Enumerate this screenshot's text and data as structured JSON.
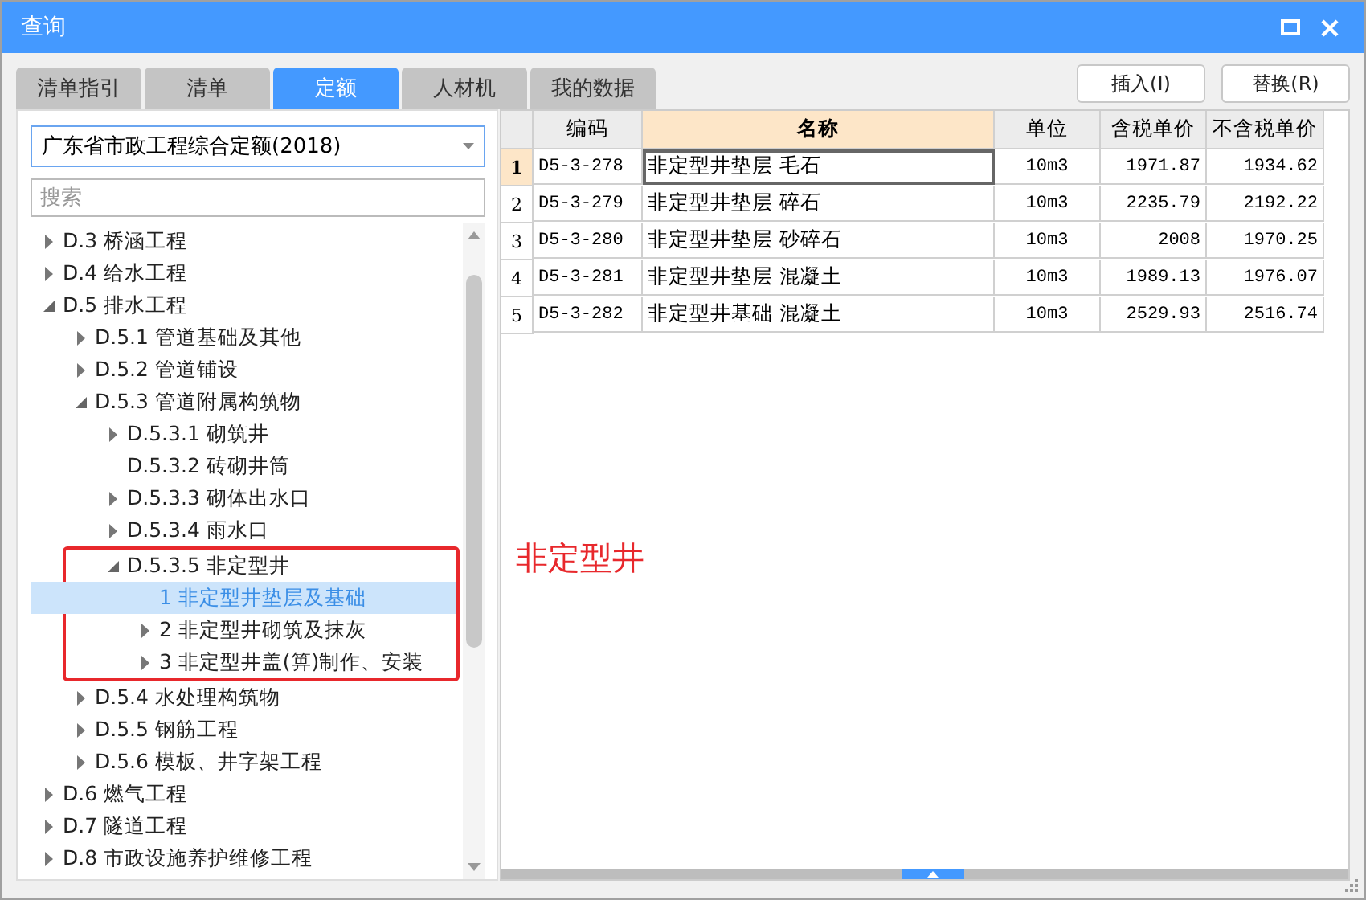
{
  "window": {
    "title": "查询"
  },
  "tabs": [
    {
      "label": "清单指引",
      "selected": false
    },
    {
      "label": "清单",
      "selected": false
    },
    {
      "label": "定额",
      "selected": true
    },
    {
      "label": "人材机",
      "selected": false
    },
    {
      "label": "我的数据",
      "selected": false
    }
  ],
  "buttons": [
    "插入(I)",
    "替换(R)"
  ],
  "library_select": {
    "value": "广东省市政工程综合定额(2018)"
  },
  "search": {
    "placeholder": "搜索"
  },
  "tree": [
    {
      "label": "D.3 桥涵工程",
      "expanded": false,
      "selected": false
    },
    {
      "label": "D.4 给水工程",
      "expanded": false,
      "selected": false
    },
    {
      "label": "D.5 排水工程",
      "expanded": true,
      "selected": false,
      "children": [
        {
          "label": "D.5.1 管道基础及其他",
          "expanded": false,
          "selected": false
        },
        {
          "label": "D.5.2 管道铺设",
          "expanded": false,
          "selected": false
        },
        {
          "label": "D.5.3 管道附属构筑物",
          "expanded": true,
          "selected": false,
          "children": [
            {
              "label": "D.5.3.1 砌筑井",
              "expanded": false,
              "selected": false
            },
            {
              "label": "D.5.3.2 砖砌井筒",
              "selected": false
            },
            {
              "label": "D.5.3.3 砌体出水口",
              "expanded": false,
              "selected": false
            },
            {
              "label": "D.5.3.4 雨水口",
              "expanded": false,
              "selected": false
            },
            {
              "label": "D.5.3.5 非定型井",
              "expanded": true,
              "selected": false,
              "highlighted": true,
              "children": [
                {
                  "label": "1 非定型井垫层及基础",
                  "selected": true
                },
                {
                  "label": "2 非定型井砌筑及抹灰",
                  "expanded": false,
                  "selected": false
                },
                {
                  "label": "3 非定型井盖(箅)制作、安装",
                  "expanded": false,
                  "selected": false
                }
              ]
            }
          ]
        },
        {
          "label": "D.5.4 水处理构筑物",
          "expanded": false,
          "selected": false
        },
        {
          "label": "D.5.5 钢筋工程",
          "expanded": false,
          "selected": false
        },
        {
          "label": "D.5.6 模板、井字架工程",
          "expanded": false,
          "selected": false
        }
      ]
    },
    {
      "label": "D.6 燃气工程",
      "expanded": false,
      "selected": false
    },
    {
      "label": "D.7 隧道工程",
      "expanded": false,
      "selected": false
    },
    {
      "label": "D.8 市政设施养护维修工程",
      "expanded": false,
      "selected": false
    }
  ],
  "table": {
    "columns": [
      {
        "label": "编码",
        "selected": false
      },
      {
        "label": "名称",
        "selected": true
      },
      {
        "label": "单位",
        "selected": false
      },
      {
        "label": "含税单价",
        "selected": false
      },
      {
        "label": "不含税单价",
        "selected": false
      }
    ],
    "rows": [
      {
        "index": "1",
        "selected": true,
        "cells": [
          "D5-3-278",
          "非定型井垫层 毛石",
          "10m3",
          "1971.87",
          "1934.62"
        ]
      },
      {
        "index": "2",
        "selected": false,
        "cells": [
          "D5-3-279",
          "非定型井垫层 碎石",
          "10m3",
          "2235.79",
          "2192.22"
        ]
      },
      {
        "index": "3",
        "selected": false,
        "cells": [
          "D5-3-280",
          "非定型井垫层 砂碎石",
          "10m3",
          "2008",
          "1970.25"
        ]
      },
      {
        "index": "4",
        "selected": false,
        "cells": [
          "D5-3-281",
          "非定型井垫层 混凝土",
          "10m3",
          "1989.13",
          "1976.07"
        ]
      },
      {
        "index": "5",
        "selected": false,
        "cells": [
          "D5-3-282",
          "非定型井基础 混凝土",
          "10m3",
          "2529.93",
          "2516.74"
        ]
      }
    ]
  },
  "annotation": "非定型井"
}
